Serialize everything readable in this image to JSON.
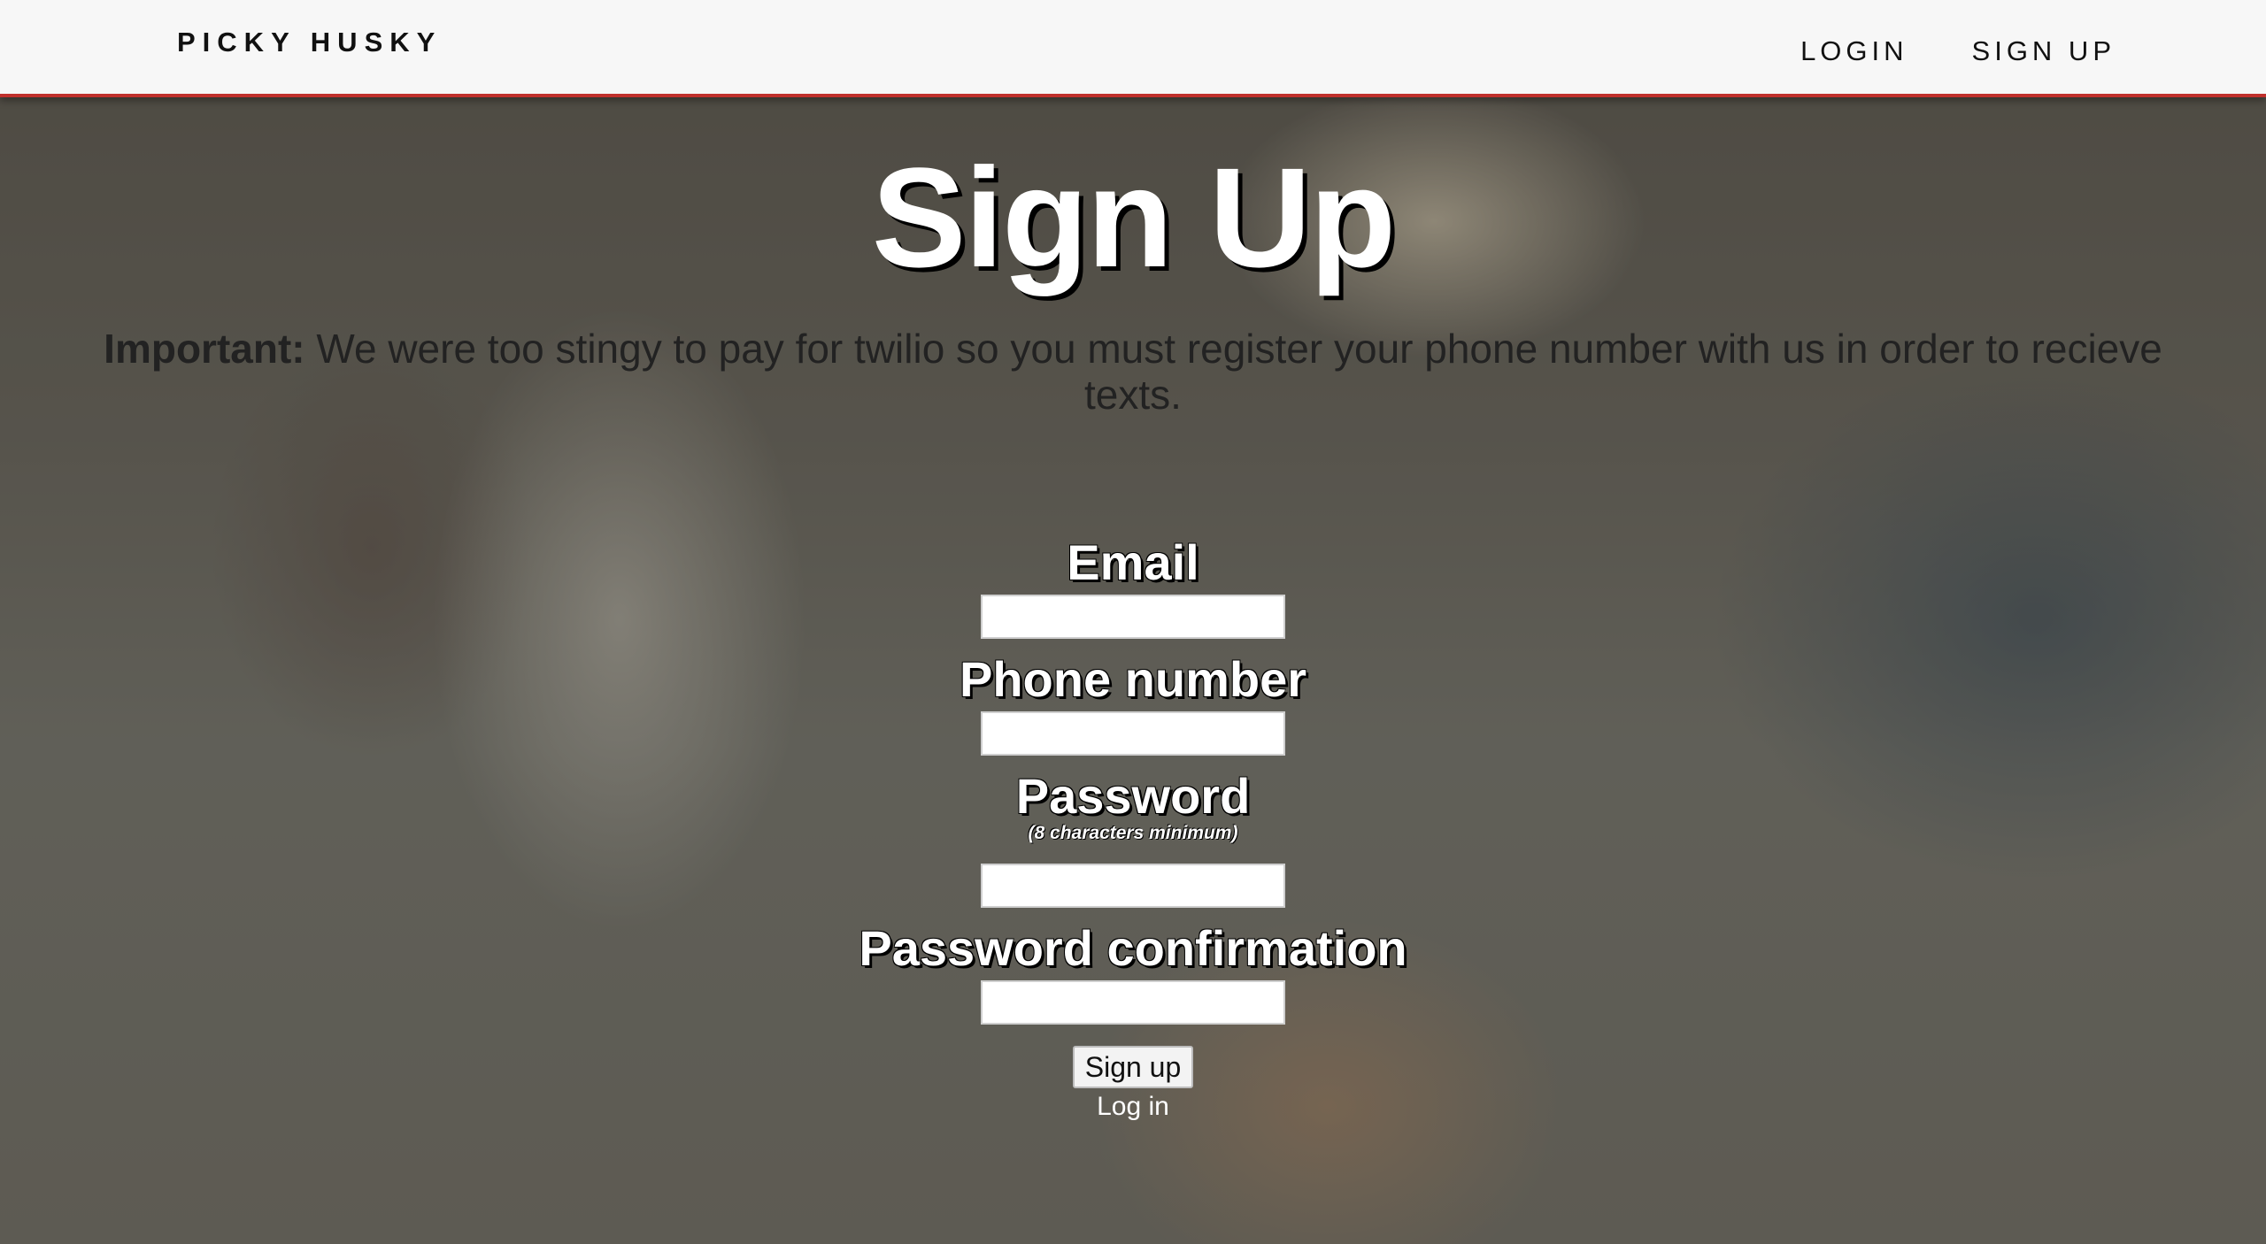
{
  "header": {
    "brand": "PICKY HUSKY",
    "nav": [
      {
        "label": "LOGIN"
      },
      {
        "label": "SIGN UP"
      }
    ]
  },
  "page": {
    "title": "Sign Up",
    "notice_strong": "Important:",
    "notice_text": " We were too stingy to pay for twilio so you must register your phone number with us in order to recieve texts."
  },
  "form": {
    "email_label": "Email",
    "email_value": "",
    "phone_label": "Phone number",
    "phone_value": "",
    "password_label": "Password",
    "password_hint": "(8 characters minimum)",
    "password_value": "",
    "confirm_label": "Password confirmation",
    "confirm_value": "",
    "submit_label": "Sign up",
    "login_link": "Log in"
  }
}
